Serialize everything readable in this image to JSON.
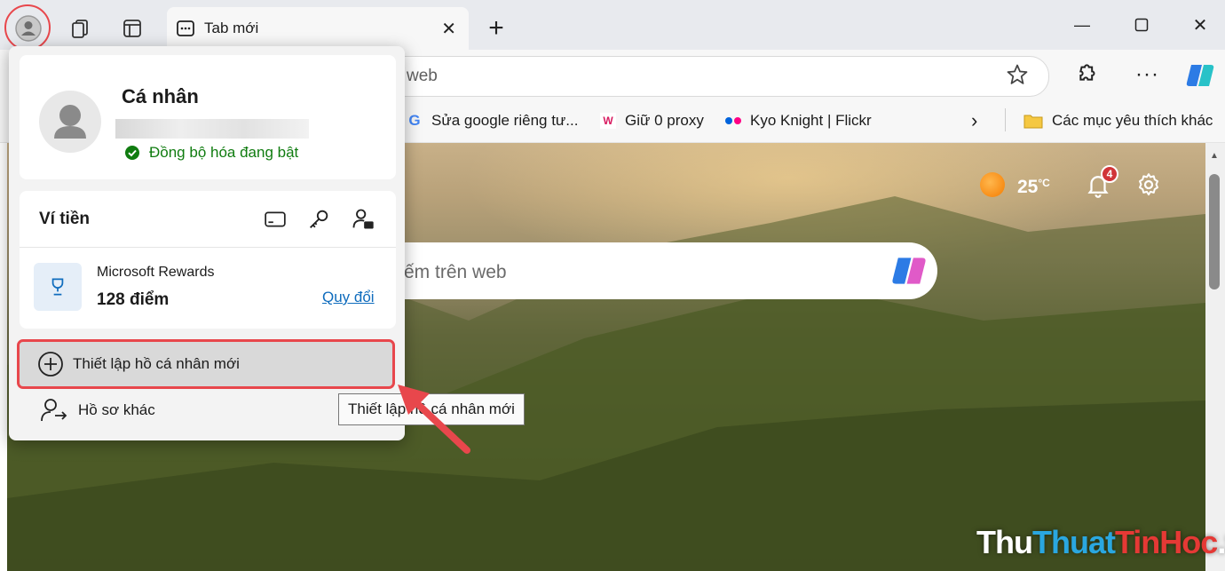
{
  "browser": {
    "tab": {
      "title": "Tab mới"
    },
    "address": {
      "text": "web"
    },
    "bookmarks": [
      {
        "label": "Sửa google riêng tư...",
        "icon": "google-icon"
      },
      {
        "label": "Giữ 0 proxy",
        "icon": "proxy-icon"
      },
      {
        "label": "Kyo Knight | Flickr",
        "icon": "flickr-icon"
      }
    ],
    "favorites_folder": "Các mục yêu thích khác"
  },
  "newtab": {
    "search_placeholder": "ếm trên web",
    "weather": {
      "temp": "25",
      "unit": "°C"
    },
    "notifications_count": "4"
  },
  "profile_flyout": {
    "name": "Cá nhân",
    "sync_status": "Đồng bộ hóa đang bật",
    "wallet": {
      "title": "Ví tiền",
      "rewards_title": "Microsoft Rewards",
      "rewards_points": "128 điểm",
      "redeem_link": "Quy đổi"
    },
    "new_profile_label": "Thiết lập hồ cá nhân mới",
    "other_profiles_label": "Hồ sơ khác",
    "tooltip": "Thiết lập hồ cá nhân mới"
  },
  "watermark": {
    "part1": "Thu",
    "part2": "Thuat",
    "part3": "TinHoc",
    "part4": ".vn"
  },
  "colors": {
    "highlight": "#e8474c",
    "accent": "#0f6cbd",
    "sync_green": "#107c10"
  }
}
